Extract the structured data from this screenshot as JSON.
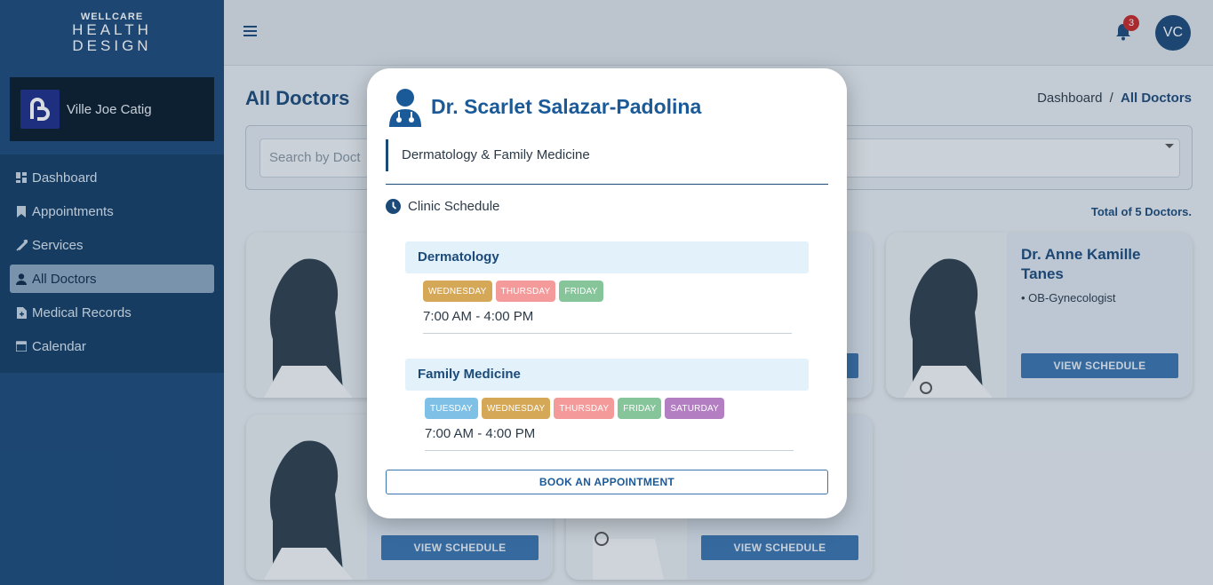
{
  "brand": {
    "line1": "WELLCARE",
    "line2": "HEALTH",
    "line3": "DESIGN"
  },
  "profile": {
    "name": "Ville Joe Catig"
  },
  "sidebar": {
    "items": [
      {
        "label": "Dashboard",
        "icon": "dashboard-icon"
      },
      {
        "label": "Appointments",
        "icon": "bookmark-icon"
      },
      {
        "label": "Services",
        "icon": "syringe-icon"
      },
      {
        "label": "All Doctors",
        "icon": "user-icon",
        "active": true
      },
      {
        "label": "Medical Records",
        "icon": "file-icon"
      },
      {
        "label": "Calendar",
        "icon": "calendar-icon"
      }
    ]
  },
  "header": {
    "notification_count": "3",
    "avatar_initials": "VC"
  },
  "page": {
    "title": "All Doctors",
    "breadcrumb": {
      "root": "Dashboard",
      "sep": "/",
      "current": "All Doctors"
    },
    "search_placeholder": "Search by Doct",
    "total": "Total of 5 Doctors."
  },
  "cards": [
    {
      "name": "",
      "spec": "",
      "button": ""
    },
    {
      "name": "",
      "spec": "",
      "button": ""
    },
    {
      "name": "Dr. Anne Kamille Tanes",
      "spec": "• OB-Gynecologist",
      "button": "VIEW SCHEDULE"
    },
    {
      "name": "",
      "spec": "",
      "button": "VIEW SCHEDULE"
    },
    {
      "name": "",
      "spec": "",
      "button": "VIEW SCHEDULE"
    }
  ],
  "modal": {
    "doctor_name": "Dr. Scarlet Salazar-Padolina",
    "specialty": "Dermatology & Family Medicine",
    "schedule_label": "Clinic Schedule",
    "schedules": [
      {
        "title": "Dermatology",
        "days": [
          {
            "label": "WEDNESDAY",
            "color": "#d4a857"
          },
          {
            "label": "THURSDAY",
            "color": "#f59a9a"
          },
          {
            "label": "FRIDAY",
            "color": "#86c49a"
          }
        ],
        "time": "7:00 AM - 4:00 PM"
      },
      {
        "title": "Family Medicine",
        "days": [
          {
            "label": "TUESDAY",
            "color": "#7fc1e6"
          },
          {
            "label": "WEDNESDAY",
            "color": "#d4a857"
          },
          {
            "label": "THURSDAY",
            "color": "#f59a9a"
          },
          {
            "label": "FRIDAY",
            "color": "#86c49a"
          },
          {
            "label": "SATURDAY",
            "color": "#b37ec2"
          }
        ],
        "time": "7:00 AM - 4:00 PM"
      }
    ],
    "book_button": "BOOK AN APPOINTMENT"
  }
}
